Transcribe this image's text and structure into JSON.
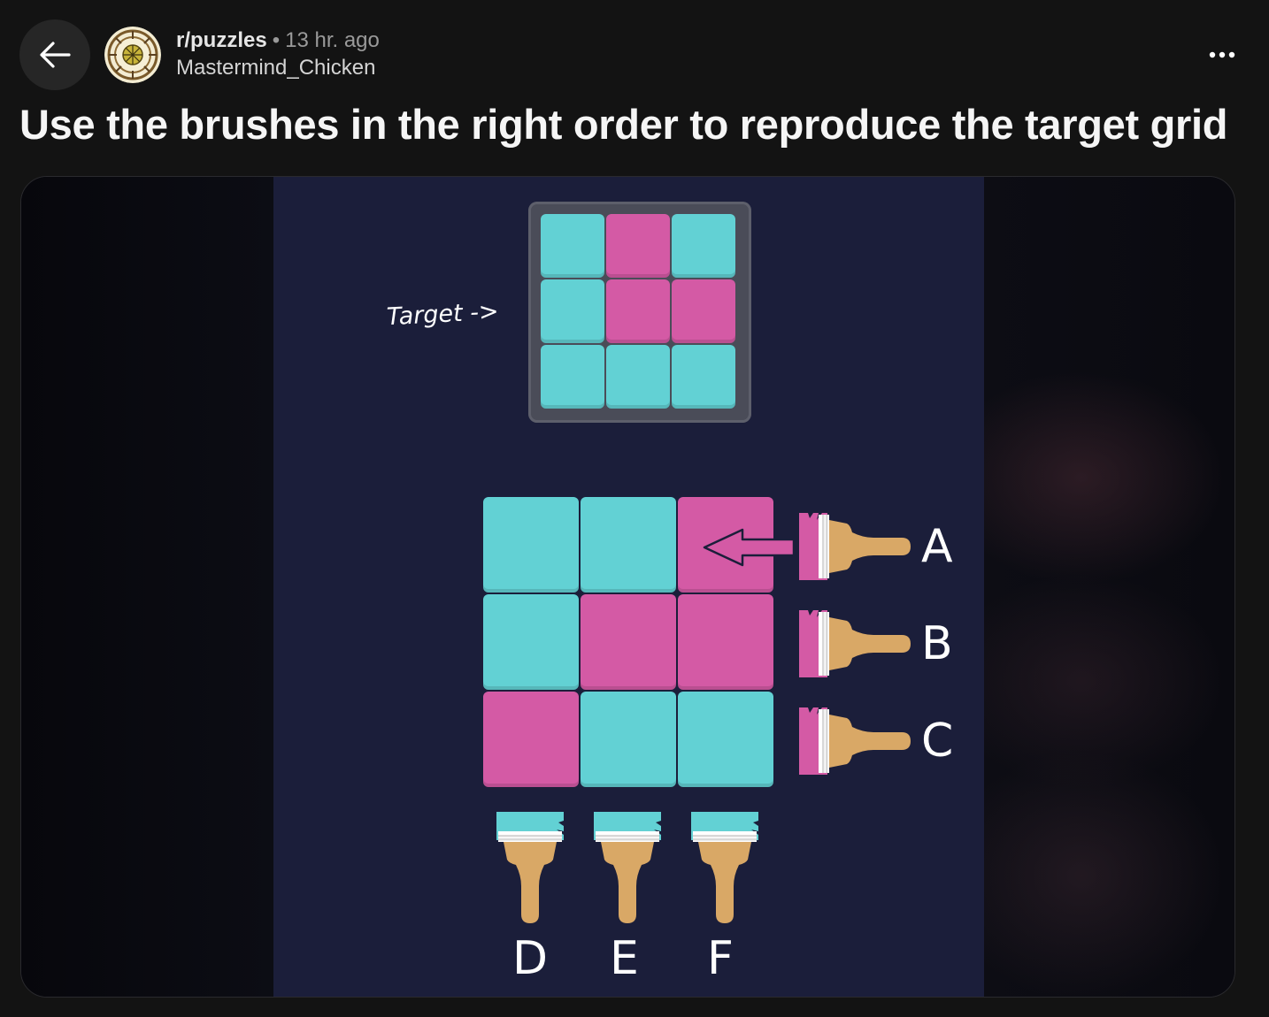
{
  "post": {
    "subreddit": "r/puzzles",
    "separator": "•",
    "age": "13 hr. ago",
    "author": "Mastermind_Chicken",
    "title": "Use the brushes in the right order to reproduce the target grid"
  },
  "icons": {
    "back": "arrow-left-icon",
    "more": "more-horizontal-icon",
    "avatar": "subreddit-avatar"
  },
  "colors": {
    "background": "#131313",
    "puzzle_background": "#1b1e3a",
    "cyan": "#62d1d4",
    "pink": "#d45aa5",
    "brush_handle": "#d9a866"
  },
  "puzzle": {
    "target_label": "Target ->",
    "target_grid": [
      [
        "cyan",
        "pink",
        "cyan"
      ],
      [
        "cyan",
        "pink",
        "pink"
      ],
      [
        "cyan",
        "cyan",
        "cyan"
      ]
    ],
    "current_grid": [
      [
        "cyan",
        "cyan",
        "pink"
      ],
      [
        "cyan",
        "pink",
        "pink"
      ],
      [
        "pink",
        "cyan",
        "cyan"
      ]
    ],
    "row_brushes": [
      {
        "label": "A",
        "color": "pink"
      },
      {
        "label": "B",
        "color": "pink"
      },
      {
        "label": "C",
        "color": "pink"
      }
    ],
    "column_brushes": [
      {
        "label": "D",
        "color": "cyan"
      },
      {
        "label": "E",
        "color": "cyan"
      },
      {
        "label": "F",
        "color": "cyan"
      }
    ]
  }
}
